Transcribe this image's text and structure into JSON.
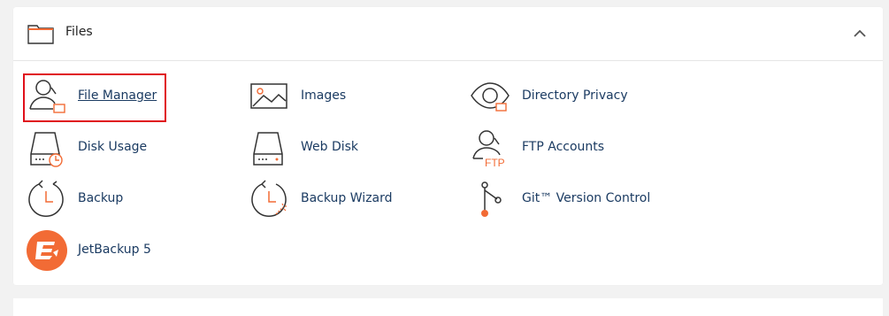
{
  "section": {
    "title": "Files",
    "header_icon": "folder-icon",
    "collapse_icon": "chevron-up-icon"
  },
  "accent_color": "#f26b35",
  "highlight_color": "#e0101a",
  "items": [
    {
      "label": "File Manager",
      "icon": "file-manager-icon"
    },
    {
      "label": "Images",
      "icon": "images-icon"
    },
    {
      "label": "Directory Privacy",
      "icon": "directory-privacy-icon"
    },
    {
      "label": "Disk Usage",
      "icon": "disk-usage-icon"
    },
    {
      "label": "Web Disk",
      "icon": "web-disk-icon"
    },
    {
      "label": "FTP Accounts",
      "icon": "ftp-accounts-icon",
      "icon_text": "FTP"
    },
    {
      "label": "Backup",
      "icon": "backup-icon"
    },
    {
      "label": "Backup Wizard",
      "icon": "backup-wizard-icon"
    },
    {
      "label": "Git™ Version Control",
      "icon": "git-icon"
    },
    {
      "label": "JetBackup 5",
      "icon": "jetbackup-icon"
    }
  ]
}
